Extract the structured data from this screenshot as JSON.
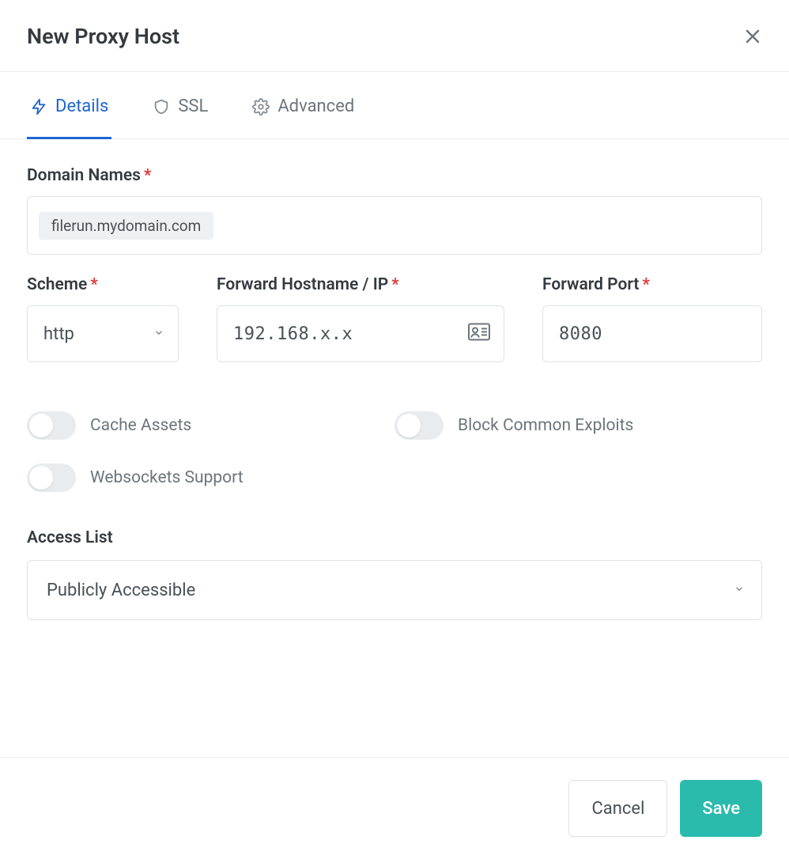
{
  "header": {
    "title": "New Proxy Host"
  },
  "tabs": {
    "details": "Details",
    "ssl": "SSL",
    "advanced": "Advanced"
  },
  "form": {
    "domain_names": {
      "label": "Domain Names",
      "value": "filerun.mydomain.com"
    },
    "scheme": {
      "label": "Scheme",
      "value": "http"
    },
    "forward_hostname": {
      "label": "Forward Hostname / IP",
      "value": "192.168.x.x"
    },
    "forward_port": {
      "label": "Forward Port",
      "value": "8080"
    },
    "toggles": {
      "cache_assets": {
        "label": "Cache Assets",
        "value": false
      },
      "block_exploits": {
        "label": "Block Common Exploits",
        "value": false
      },
      "websockets": {
        "label": "Websockets Support",
        "value": false
      }
    },
    "access_list": {
      "label": "Access List",
      "value": "Publicly Accessible"
    }
  },
  "footer": {
    "cancel": "Cancel",
    "save": "Save"
  }
}
